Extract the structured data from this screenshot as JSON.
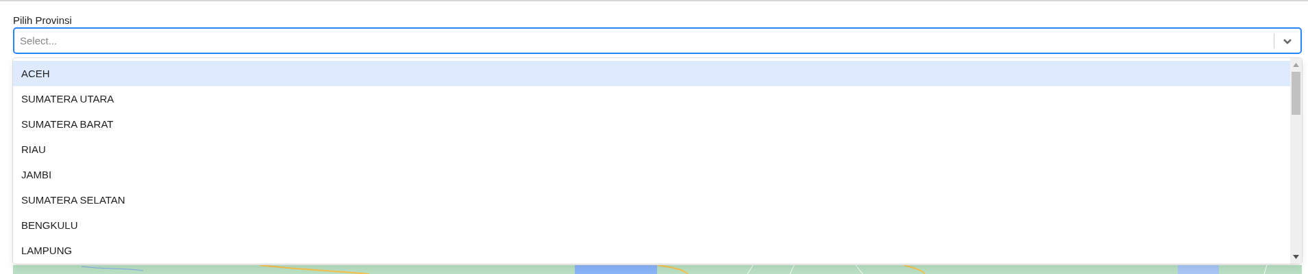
{
  "province_field": {
    "label": "Pilih Provinsi",
    "placeholder": "Select...",
    "expanded": true
  },
  "options": [
    {
      "label": "ACEH",
      "selected": true
    },
    {
      "label": "SUMATERA UTARA",
      "selected": false
    },
    {
      "label": "SUMATERA BARAT",
      "selected": false
    },
    {
      "label": "RIAU",
      "selected": false
    },
    {
      "label": "JAMBI",
      "selected": false
    },
    {
      "label": "SUMATERA SELATAN",
      "selected": false
    },
    {
      "label": "BENGKULU",
      "selected": false
    },
    {
      "label": "LAMPUNG",
      "selected": false
    }
  ]
}
